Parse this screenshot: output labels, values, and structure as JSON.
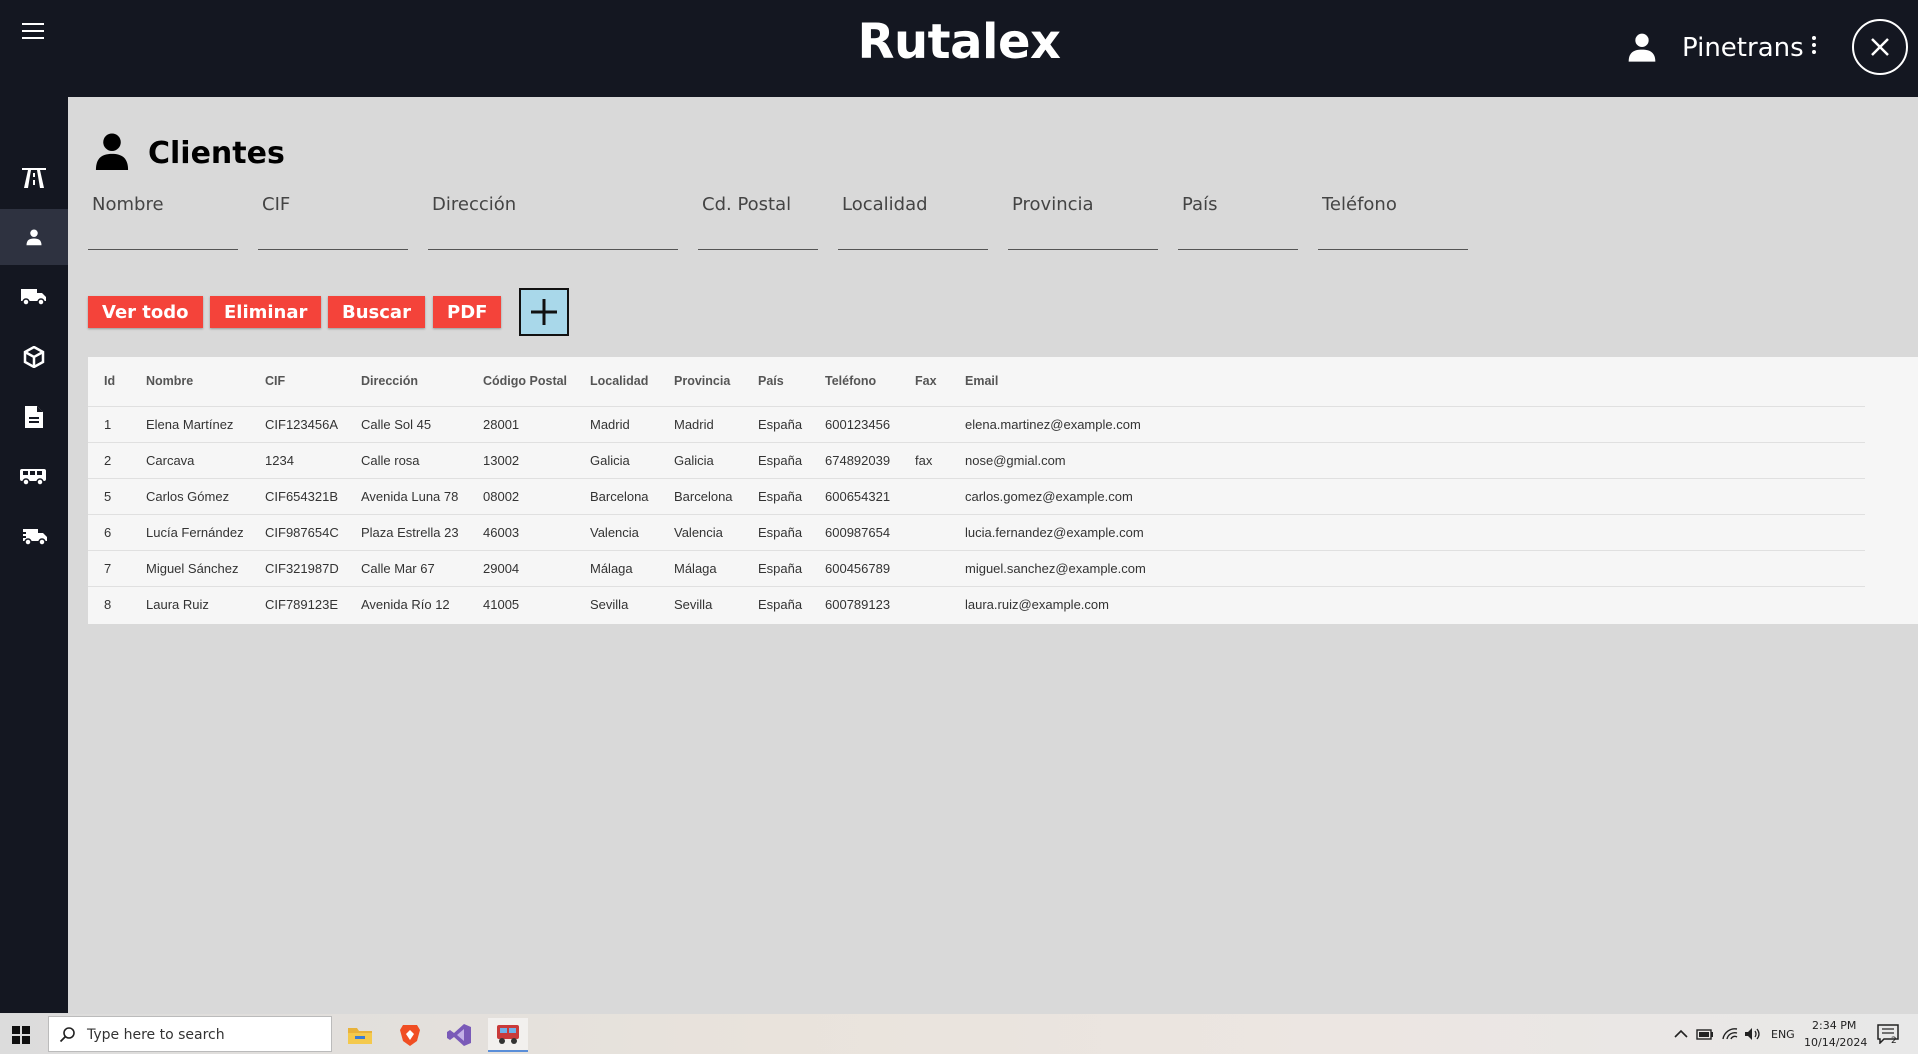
{
  "header": {
    "app_title": "Rutalex",
    "user_name": "Pinetrans"
  },
  "sidebar": {
    "items": [
      {
        "icon": "road-icon"
      },
      {
        "icon": "person-icon",
        "active": true
      },
      {
        "icon": "truck-icon"
      },
      {
        "icon": "box-icon"
      },
      {
        "icon": "document-icon"
      },
      {
        "icon": "bus-icon"
      },
      {
        "icon": "truck-fast-icon"
      }
    ]
  },
  "page": {
    "title": "Clientes"
  },
  "filters": {
    "nombre": "Nombre",
    "cif": "CIF",
    "direccion": "Dirección",
    "cd_postal": "Cd. Postal",
    "localidad": "Localidad",
    "provincia": "Provincia",
    "pais": "País",
    "telefono": "Teléfono"
  },
  "buttons": {
    "ver_todo": "Ver todo",
    "eliminar": "Eliminar",
    "buscar": "Buscar",
    "pdf": "PDF"
  },
  "table": {
    "headers": [
      "Id",
      "Nombre",
      "CIF",
      "Dirección",
      "Código Postal",
      "Localidad",
      "Provincia",
      "País",
      "Teléfono",
      "Fax",
      "Email"
    ],
    "rows": [
      [
        "1",
        "Elena Martínez",
        "CIF123456A",
        "Calle Sol 45",
        "28001",
        "Madrid",
        "Madrid",
        "España",
        "600123456",
        "",
        "elena.martinez@example.com"
      ],
      [
        "2",
        "Carcava",
        "1234",
        "Calle rosa",
        "13002",
        "Galicia",
        "Galicia",
        "España",
        "674892039",
        "fax",
        "nose@gmial.com"
      ],
      [
        "5",
        "Carlos Gómez",
        "CIF654321B",
        "Avenida Luna 78",
        "08002",
        "Barcelona",
        "Barcelona",
        "España",
        "600654321",
        "",
        "carlos.gomez@example.com"
      ],
      [
        "6",
        "Lucía Fernández",
        "CIF987654C",
        "Plaza Estrella 23",
        "46003",
        "Valencia",
        "Valencia",
        "España",
        "600987654",
        "",
        "lucia.fernandez@example.com"
      ],
      [
        "7",
        "Miguel Sánchez",
        "CIF321987D",
        "Calle Mar 67",
        "29004",
        "Málaga",
        "Málaga",
        "España",
        "600456789",
        "",
        "miguel.sanchez@example.com"
      ],
      [
        "8",
        "Laura Ruiz",
        "CIF789123E",
        "Avenida Río 12",
        "41005",
        "Sevilla",
        "Sevilla",
        "España",
        "600789123",
        "",
        "laura.ruiz@example.com"
      ]
    ]
  },
  "taskbar": {
    "search_placeholder": "Type here to search",
    "language": "ENG",
    "time": "2:34 PM",
    "date": "10/14/2024",
    "notification_count": "2"
  },
  "colors": {
    "header_bg": "#141721",
    "accent_red": "#f4433a",
    "add_button_bg": "#a9d8ea",
    "page_bg": "#d9d9d9"
  }
}
